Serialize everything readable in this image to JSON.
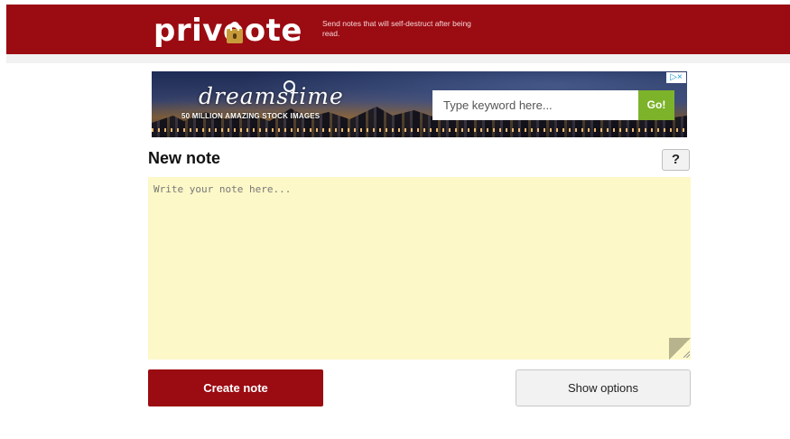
{
  "header": {
    "logo_before": "priv",
    "logo_o": "o",
    "logo_after": "ote",
    "tagline": "Send notes that will self-destruct after being read.",
    "brand_color": "#9b0b12"
  },
  "ad": {
    "brand": "dreamstime",
    "tagline": "50 MILLION AMAZING STOCK IMAGES",
    "search_placeholder": "Type keyword here...",
    "go_label": "Go!",
    "choices_label": "▷×",
    "go_color": "#7cb32a"
  },
  "note": {
    "title": "New note",
    "help_label": "?",
    "placeholder": "Write your note here...",
    "value": "",
    "background": "#fdf8c8"
  },
  "actions": {
    "create_label": "Create note",
    "options_label": "Show options"
  }
}
